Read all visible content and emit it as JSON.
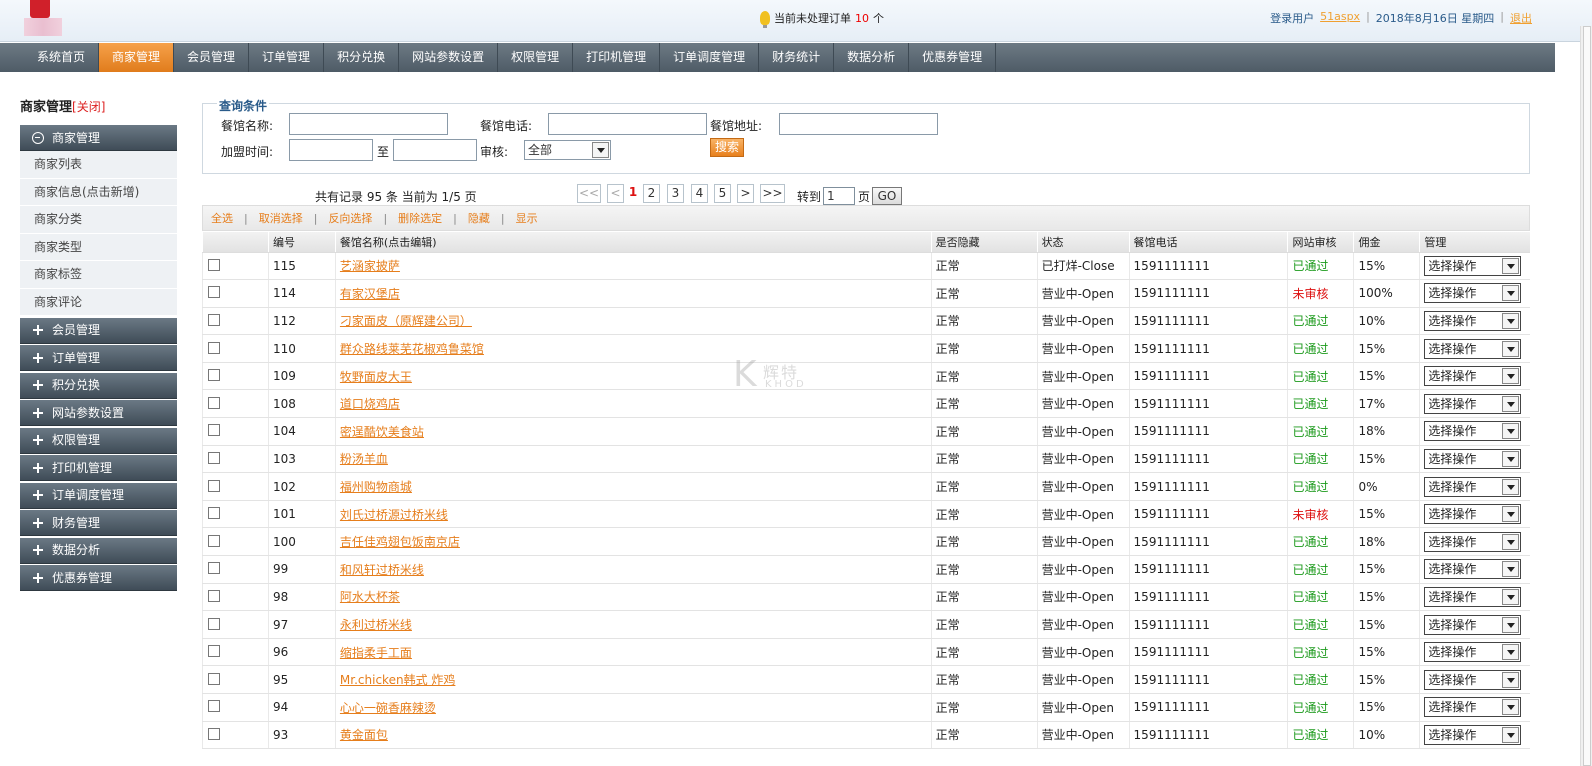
{
  "header": {
    "notice_prefix": "当前未处理订单",
    "notice_count": "10",
    "notice_suffix": "个",
    "user_label": "登录用户",
    "user_name": "51aspx",
    "date": "2018年8月16日 星期四",
    "logout": "退出"
  },
  "topnav": {
    "items": [
      "系统首页",
      "商家管理",
      "会员管理",
      "订单管理",
      "积分兑换",
      "网站参数设置",
      "权限管理",
      "打印机管理",
      "订单调度管理",
      "财务统计",
      "数据分析",
      "优惠券管理"
    ],
    "active_index": 1
  },
  "sidebar": {
    "title": "商家管理",
    "close": "[关闭]",
    "expanded_group": "商家管理",
    "sub_items": [
      "商家列表",
      "商家信息(点击新增)",
      "商家分类",
      "商家类型",
      "商家标签",
      "商家评论"
    ],
    "groups": [
      "会员管理",
      "订单管理",
      "积分兑换",
      "网站参数设置",
      "权限管理",
      "打印机管理",
      "订单调度管理",
      "财务管理",
      "数据分析",
      "优惠券管理"
    ]
  },
  "query": {
    "legend": "查询条件",
    "name_label": "餐馆名称:",
    "phone_label": "餐馆电话:",
    "address_label": "餐馆地址:",
    "join_label": "加盟时间:",
    "to_label": "至",
    "audit_label": "审核:",
    "audit_value": "全部",
    "search_button": "搜索"
  },
  "pager": {
    "info": "共有记录 95 条 当前为 1/5 页",
    "first": "<<",
    "prev": "<",
    "pages": [
      "1",
      "2",
      "3",
      "4",
      "5"
    ],
    "current": "1",
    "next": ">",
    "last": ">>",
    "goto_label": "转到",
    "goto_value": "1",
    "page_label": "页",
    "go": "GO"
  },
  "actions": [
    "全选",
    "取消选择",
    "反向选择",
    "删除选定",
    "隐藏",
    "显示"
  ],
  "table": {
    "headers": [
      "",
      "编号",
      "餐馆名称(点击编辑)",
      "是否隐藏",
      "状态",
      "餐馆电话",
      "网站审核",
      "佣金",
      "管理"
    ],
    "manage_label": "选择操作",
    "rows": [
      {
        "id": "115",
        "name": "艺涵家披萨",
        "hidden": "正常",
        "status": "已打烊-Close",
        "phone": "1591111111",
        "audit": "已通过",
        "audit_ok": true,
        "commission": "15%"
      },
      {
        "id": "114",
        "name": "有家汉堡店",
        "hidden": "正常",
        "status": "营业中-Open",
        "phone": "1591111111",
        "audit": "未审核",
        "audit_ok": false,
        "commission": "100%"
      },
      {
        "id": "112",
        "name": "刁家面皮（原辉建公司）",
        "hidden": "正常",
        "status": "营业中-Open",
        "phone": "1591111111",
        "audit": "已通过",
        "audit_ok": true,
        "commission": "10%"
      },
      {
        "id": "110",
        "name": "群众路线莱芜花椒鸡鲁菜馆",
        "hidden": "正常",
        "status": "营业中-Open",
        "phone": "1591111111",
        "audit": "已通过",
        "audit_ok": true,
        "commission": "15%"
      },
      {
        "id": "109",
        "name": "牧野面皮大王",
        "hidden": "正常",
        "status": "营业中-Open",
        "phone": "1591111111",
        "audit": "已通过",
        "audit_ok": true,
        "commission": "15%"
      },
      {
        "id": "108",
        "name": "道口烧鸡店",
        "hidden": "正常",
        "status": "营业中-Open",
        "phone": "1591111111",
        "audit": "已通过",
        "audit_ok": true,
        "commission": "17%"
      },
      {
        "id": "104",
        "name": "密逞酷饮美食站",
        "hidden": "正常",
        "status": "营业中-Open",
        "phone": "1591111111",
        "audit": "已通过",
        "audit_ok": true,
        "commission": "18%"
      },
      {
        "id": "103",
        "name": "粉汤羊血",
        "hidden": "正常",
        "status": "营业中-Open",
        "phone": "1591111111",
        "audit": "已通过",
        "audit_ok": true,
        "commission": "15%"
      },
      {
        "id": "102",
        "name": "福州购物商城",
        "hidden": "正常",
        "status": "营业中-Open",
        "phone": "1591111111",
        "audit": "已通过",
        "audit_ok": true,
        "commission": "0%"
      },
      {
        "id": "101",
        "name": "刘氏过桥源过桥米线",
        "hidden": "正常",
        "status": "营业中-Open",
        "phone": "1591111111",
        "audit": "未审核",
        "audit_ok": false,
        "commission": "15%"
      },
      {
        "id": "100",
        "name": "吉任佳鸡翅包饭南京店",
        "hidden": "正常",
        "status": "营业中-Open",
        "phone": "1591111111",
        "audit": "已通过",
        "audit_ok": true,
        "commission": "18%"
      },
      {
        "id": "99",
        "name": "和风轩过桥米线",
        "hidden": "正常",
        "status": "营业中-Open",
        "phone": "1591111111",
        "audit": "已通过",
        "audit_ok": true,
        "commission": "15%"
      },
      {
        "id": "98",
        "name": "阿水大杯茶",
        "hidden": "正常",
        "status": "营业中-Open",
        "phone": "1591111111",
        "audit": "已通过",
        "audit_ok": true,
        "commission": "15%"
      },
      {
        "id": "97",
        "name": "永利过桥米线",
        "hidden": "正常",
        "status": "营业中-Open",
        "phone": "1591111111",
        "audit": "已通过",
        "audit_ok": true,
        "commission": "15%"
      },
      {
        "id": "96",
        "name": "缩指柔手工面",
        "hidden": "正常",
        "status": "营业中-Open",
        "phone": "1591111111",
        "audit": "已通过",
        "audit_ok": true,
        "commission": "15%"
      },
      {
        "id": "95",
        "name": "Mr.chicken韩式 炸鸡",
        "hidden": "正常",
        "status": "营业中-Open",
        "phone": "1591111111",
        "audit": "已通过",
        "audit_ok": true,
        "commission": "15%"
      },
      {
        "id": "94",
        "name": "心心一碗香麻辣烫",
        "hidden": "正常",
        "status": "营业中-Open",
        "phone": "1591111111",
        "audit": "已通过",
        "audit_ok": true,
        "commission": "15%"
      },
      {
        "id": "93",
        "name": "黄金面包",
        "hidden": "正常",
        "status": "营业中-Open",
        "phone": "1591111111",
        "audit": "已通过",
        "audit_ok": true,
        "commission": "10%"
      }
    ]
  },
  "watermark": {
    "letter": "K",
    "text": "辉特",
    "sub": "KHOD"
  },
  "colors": {
    "accent": "#e67e1c",
    "nav": "#56636e",
    "ok": "#1c9a1c",
    "bad": "#dd1111"
  }
}
